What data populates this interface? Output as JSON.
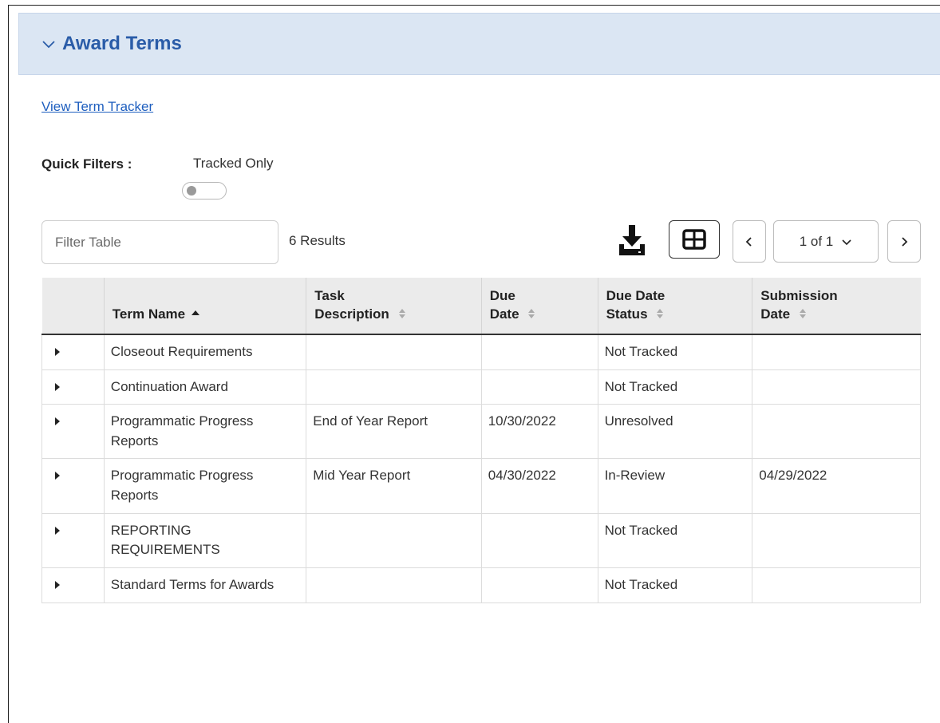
{
  "panel": {
    "title": "Award Terms"
  },
  "links": {
    "term_tracker": "View Term Tracker"
  },
  "quick_filters": {
    "label": "Quick Filters :",
    "tracked_only_label": "Tracked Only",
    "tracked_only_on": false
  },
  "toolbar": {
    "filter_placeholder": "Filter Table",
    "results_text": "6 Results",
    "page_select": "1 of 1"
  },
  "table": {
    "columns": [
      {
        "label": "",
        "sort": "none"
      },
      {
        "label": "Term Name",
        "sort": "asc"
      },
      {
        "label": "Task Description",
        "sort": "sortable"
      },
      {
        "label": "Due Date",
        "sort": "sortable"
      },
      {
        "label": "Due Date Status",
        "sort": "sortable"
      },
      {
        "label": "Submission Date",
        "sort": "sortable"
      }
    ],
    "rows": [
      {
        "term_name": "Closeout Requirements",
        "task_description": "",
        "due_date": "",
        "status": "Not Tracked",
        "submission_date": ""
      },
      {
        "term_name": "Continuation Award",
        "task_description": "",
        "due_date": "",
        "status": "Not Tracked",
        "submission_date": ""
      },
      {
        "term_name": "Programmatic Progress Reports",
        "task_description": "End of Year Report",
        "due_date": "10/30/2022",
        "status": "Unresolved",
        "submission_date": ""
      },
      {
        "term_name": "Programmatic Progress Reports",
        "task_description": "Mid Year Report",
        "due_date": "04/30/2022",
        "status": "In-Review",
        "submission_date": "04/29/2022"
      },
      {
        "term_name": "REPORTING REQUIREMENTS",
        "task_description": "",
        "due_date": "",
        "status": "Not Tracked",
        "submission_date": ""
      },
      {
        "term_name": "Standard Terms for Awards",
        "task_description": "",
        "due_date": "",
        "status": "Not Tracked",
        "submission_date": ""
      }
    ]
  },
  "icons": {
    "collapse": "chevron-down-icon",
    "download": "download-icon",
    "columns": "table-columns-icon",
    "prev": "chevron-left-icon",
    "next": "chevron-right-icon",
    "expand_row": "caret-right-icon"
  }
}
